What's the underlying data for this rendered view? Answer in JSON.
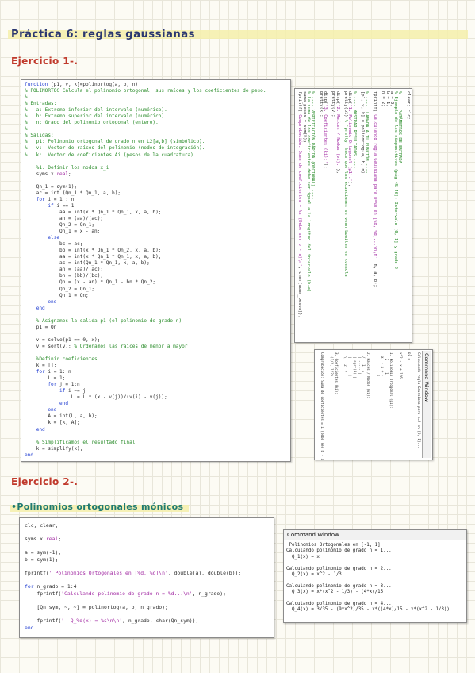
{
  "page_title": "Práctica 6: reglas gaussianas",
  "exercise1_heading": "Ejercicio 1-.",
  "exercise2_heading": "Ejercicio 2-.",
  "monic_heading": "•Polinomios ortogonales mónicos",
  "function_code": [
    [
      {
        "t": "function",
        "c": "k"
      },
      {
        "t": " [p1, v, k]=polinortog(a, b, n)"
      }
    ],
    [
      {
        "t": "% POLINORTOG Calcula el polinomio ortogonal, sus raíces y los coeficientes de peso.",
        "c": "c"
      }
    ],
    [
      {
        "t": "%",
        "c": "c"
      }
    ],
    [
      {
        "t": "% Entradas:",
        "c": "c"
      }
    ],
    [
      {
        "t": "%   a: Extremo inferior del intervalo (numérico).",
        "c": "c"
      }
    ],
    [
      {
        "t": "%   b: Extremo superior del intervalo (numérico).",
        "c": "c"
      }
    ],
    [
      {
        "t": "%   n: Grado del polinomio ortogonal (entero).",
        "c": "c"
      }
    ],
    [
      {
        "t": "%",
        "c": "c"
      }
    ],
    [
      {
        "t": "% Salidas:",
        "c": "c"
      }
    ],
    [
      {
        "t": "%   p1: Polinomio ortogonal de grado n en L2[a,b] (simbólico).",
        "c": "c"
      }
    ],
    [
      {
        "t": "%   v:  Vector de raíces del polinomio (nodos de integración).",
        "c": "c"
      }
    ],
    [
      {
        "t": "%   k:  Vector de coeficientes Ai (pesos de la cuadratura).",
        "c": "c"
      }
    ],
    [
      {
        "t": ""
      }
    ],
    [
      {
        "t": "    %1. Definir los nodos x_i",
        "c": "c"
      }
    ],
    [
      {
        "t": "    syms x "
      },
      {
        "t": "real",
        "c": "s"
      },
      {
        "t": ";"
      }
    ],
    [
      {
        "t": ""
      }
    ],
    [
      {
        "t": "    Qn_1 = sym(1);"
      }
    ],
    [
      {
        "t": "    ac = int (Qn_1 * Qn_1, a, b);"
      }
    ],
    [
      {
        "t": "    "
      },
      {
        "t": "for",
        "c": "k"
      },
      {
        "t": " i = 1 : n"
      }
    ],
    [
      {
        "t": "        "
      },
      {
        "t": "if",
        "c": "k"
      },
      {
        "t": " i == 1"
      }
    ],
    [
      {
        "t": "            aa = int(x * Qn_1 * Qn_1, x, a, b);"
      }
    ],
    [
      {
        "t": "            an = (aa)/(ac);"
      }
    ],
    [
      {
        "t": "            Qn_2 = Qn_1;"
      }
    ],
    [
      {
        "t": "            Qn_1 = x - an;"
      }
    ],
    [
      {
        "t": "        "
      },
      {
        "t": "else",
        "c": "k"
      }
    ],
    [
      {
        "t": "            bc = ac;"
      }
    ],
    [
      {
        "t": "            bb = int(x * Qn_1 * Qn_2, x, a, b);"
      }
    ],
    [
      {
        "t": "            aa = int(x * Qn_1 * Qn_1, x, a, b);"
      }
    ],
    [
      {
        "t": "            ac = int(Qn_1 * Qn_1, x, a, b);"
      }
    ],
    [
      {
        "t": "            an = (aa)/(ac);"
      }
    ],
    [
      {
        "t": "            bn = (bb)/(bc);"
      }
    ],
    [
      {
        "t": "            Qn = (x - an) * Qn_1 - bn * Qn_2;"
      }
    ],
    [
      {
        "t": "            Qn_2 = Qn_1;"
      }
    ],
    [
      {
        "t": "            Qn_1 = Qn;"
      }
    ],
    [
      {
        "t": "        "
      },
      {
        "t": "end",
        "c": "k"
      }
    ],
    [
      {
        "t": "    "
      },
      {
        "t": "end",
        "c": "k"
      }
    ],
    [
      {
        "t": ""
      }
    ],
    [
      {
        "t": "    % Asignamos la salida p1 (el polinomio de grado n)",
        "c": "c"
      }
    ],
    [
      {
        "t": "    p1 = Qn"
      }
    ],
    [
      {
        "t": ""
      }
    ],
    [
      {
        "t": "    v = solve(p1 == 0, x);"
      }
    ],
    [
      {
        "t": "    v = sort(v); "
      },
      {
        "t": "% Ordenamos las raíces de menor a mayor",
        "c": "c"
      }
    ],
    [
      {
        "t": ""
      }
    ],
    [
      {
        "t": "    %Definir coeficientes",
        "c": "c"
      }
    ],
    [
      {
        "t": "    k = [];"
      }
    ],
    [
      {
        "t": "    "
      },
      {
        "t": "for",
        "c": "k"
      },
      {
        "t": " i = 1: n"
      }
    ],
    [
      {
        "t": "        L = 1;"
      }
    ],
    [
      {
        "t": "        "
      },
      {
        "t": "for",
        "c": "k"
      },
      {
        "t": " j = 1:n"
      }
    ],
    [
      {
        "t": "            "
      },
      {
        "t": "if",
        "c": "k"
      },
      {
        "t": " i ~= j"
      }
    ],
    [
      {
        "t": "                L = L * (x - v(j))/(v(i) - v(j));"
      }
    ],
    [
      {
        "t": "            "
      },
      {
        "t": "end",
        "c": "k"
      }
    ],
    [
      {
        "t": "        "
      },
      {
        "t": "end",
        "c": "k"
      }
    ],
    [
      {
        "t": "        A = int(L, a, b);"
      }
    ],
    [
      {
        "t": "        k = [k, A];"
      }
    ],
    [
      {
        "t": "    "
      },
      {
        "t": "end",
        "c": "k"
      }
    ],
    [
      {
        "t": ""
      }
    ],
    [
      {
        "t": "    % Simplificamos el resultado final",
        "c": "c"
      }
    ],
    [
      {
        "t": "    k = simplify(k);"
      }
    ],
    [
      {
        "t": "end",
        "c": "k"
      }
    ]
  ],
  "script_code": [
    [
      {
        "t": "clear; clc;"
      }
    ],
    [
      {
        "t": ""
      }
    ],
    [
      {
        "t": "% ---- PARÁMETROS DE ENTRADA ----",
        "c": "c"
      }
    ],
    [
      {
        "t": "% Ejemplo de las diapositivas (pág 45-46): Intervalo [0, 1] y grado 2",
        "c": "c"
      }
    ],
    [
      {
        "t": "a = 0;"
      }
    ],
    [
      {
        "t": "b = 1;"
      }
    ],
    [
      {
        "t": "n = 2;"
      }
    ],
    [
      {
        "t": ""
      }
    ],
    [
      {
        "t": "fprintf("
      },
      {
        "t": "'Calculando regla Gaussiana para n=%d en [%d, %d]...\\n\\n'",
        "c": "s"
      },
      {
        "t": ", n, a, b);"
      }
    ],
    [
      {
        "t": ""
      }
    ],
    [
      {
        "t": "% ---- LLAMADA A TU FUNCIÓN ----",
        "c": "c"
      }
    ],
    [
      {
        "t": "[p1, v, k] = polinortog(a, b, n);"
      }
    ],
    [
      {
        "t": ""
      }
    ],
    [
      {
        "t": "% ---- MOSTRAR RESULTADOS ----",
        "c": "c"
      }
    ],
    [
      {
        "t": "disp("
      },
      {
        "t": "'1. Polinomio Ortogonal (p1):'",
        "c": "s"
      },
      {
        "t": ");"
      }
    ],
    [
      {
        "t": "pretty(p1) "
      },
      {
        "t": "% 'pretty' hace que las ecuaciones se vean bonitas en consola",
        "c": "c"
      }
    ],
    [
      {
        "t": ""
      }
    ],
    [
      {
        "t": "disp("
      },
      {
        "t": "'2. Raíces / Nodos (vi):'",
        "c": "s"
      },
      {
        "t": ");"
      }
    ],
    [
      {
        "t": "pretty(v);"
      }
    ],
    [
      {
        "t": ""
      }
    ],
    [
      {
        "t": "disp("
      },
      {
        "t": "'3. Coeficientes (ki):'",
        "c": "s"
      },
      {
        "t": ");"
      }
    ],
    [
      {
        "t": "pretty(k);"
      }
    ],
    [
      {
        "t": ""
      }
    ],
    [
      {
        "t": "% ---- VERIFICACIÓN RÁPIDA (OPCIONAL) ----",
        "c": "c"
      }
    ],
    [
      {
        "t": "% La suma de los coeficientes debe ser igual a la longitud del intervalo (b-a)",
        "c": "c"
      }
    ],
    [
      {
        "t": "suma_pesos = sum(k);"
      }
    ],
    [
      {
        "t": "fprintf("
      },
      {
        "t": "'Comprobación: Suma de coeficientes = %s (Debe ser b - a)\\n'",
        "c": "s"
      },
      {
        "t": ", char(suma_pesos));"
      }
    ]
  ],
  "small_window": {
    "title": "Command Window",
    "lines": [
      "Calculando regla Gaussiana para n=2 en [0, 1]...",
      "",
      "p1 =",
      "",
      "x^2 - x + 1/6",
      "",
      "1. Polinomio Ortogonal (p1):",
      "   2      1",
      "  x  - x + -",
      "           6",
      "",
      "2. Raíces / Nodos (vi):",
      "  /   1  \\",
      "  | ----- |",
      "  | sqrt(3) |",
      "  |        |",
      "  \\   2  /",
      "",
      "3. Coeficientes (ki):",
      "  (1/2, 1/2)",
      "",
      "Comprobación: Suma de coeficientes = 1 (Debe ser b - a)"
    ]
  },
  "monic_code": [
    [
      {
        "t": "clc; clear;"
      }
    ],
    [
      {
        "t": ""
      }
    ],
    [
      {
        "t": "syms x "
      },
      {
        "t": "real",
        "c": "s"
      },
      {
        "t": ";"
      }
    ],
    [
      {
        "t": ""
      }
    ],
    [
      {
        "t": "a = sym(-1);"
      }
    ],
    [
      {
        "t": "b = sym(1);"
      }
    ],
    [
      {
        "t": ""
      }
    ],
    [
      {
        "t": "fprintf("
      },
      {
        "t": "' Polinomios Ortogonales en [%d, %d]\\n'",
        "c": "s"
      },
      {
        "t": ", double(a), double(b));"
      }
    ],
    [
      {
        "t": ""
      }
    ],
    [
      {
        "t": "for",
        "c": "k"
      },
      {
        "t": " n_grado = 1:4"
      }
    ],
    [
      {
        "t": "    fprintf("
      },
      {
        "t": "'Calculando polinomio de grado n = %d...\\n'",
        "c": "s"
      },
      {
        "t": ", n_grado);"
      }
    ],
    [
      {
        "t": ""
      }
    ],
    [
      {
        "t": "    [Qn_sym, ~, ~] = polinortog(a, b, n_grado);"
      }
    ],
    [
      {
        "t": ""
      }
    ],
    [
      {
        "t": "    fprintf("
      },
      {
        "t": "'  Q_%d(x) = %s\\n\\n'",
        "c": "s"
      },
      {
        "t": ", n_grado, char(Qn_sym));"
      }
    ],
    [
      {
        "t": "end",
        "c": "k"
      }
    ]
  ],
  "command_window": {
    "title": "Command Window",
    "lines": [
      " Polinomios Ortogonales en [-1, 1]",
      "Calculando polinomio de grado n = 1...",
      "  Q_1(x) = x",
      "",
      "Calculando polinomio de grado n = 2...",
      "  Q_2(x) = x^2 - 1/3",
      "",
      "Calculando polinomio de grado n = 3...",
      "  Q_3(x) = x*(x^2 - 1/3) - (4*x)/15",
      "",
      "Calculando polinomio de grado n = 4...",
      "  Q_4(x) = 3/35 - (9*x^2)/35 - x*((4*x)/15 - x*(x^2 - 1/3))"
    ]
  }
}
